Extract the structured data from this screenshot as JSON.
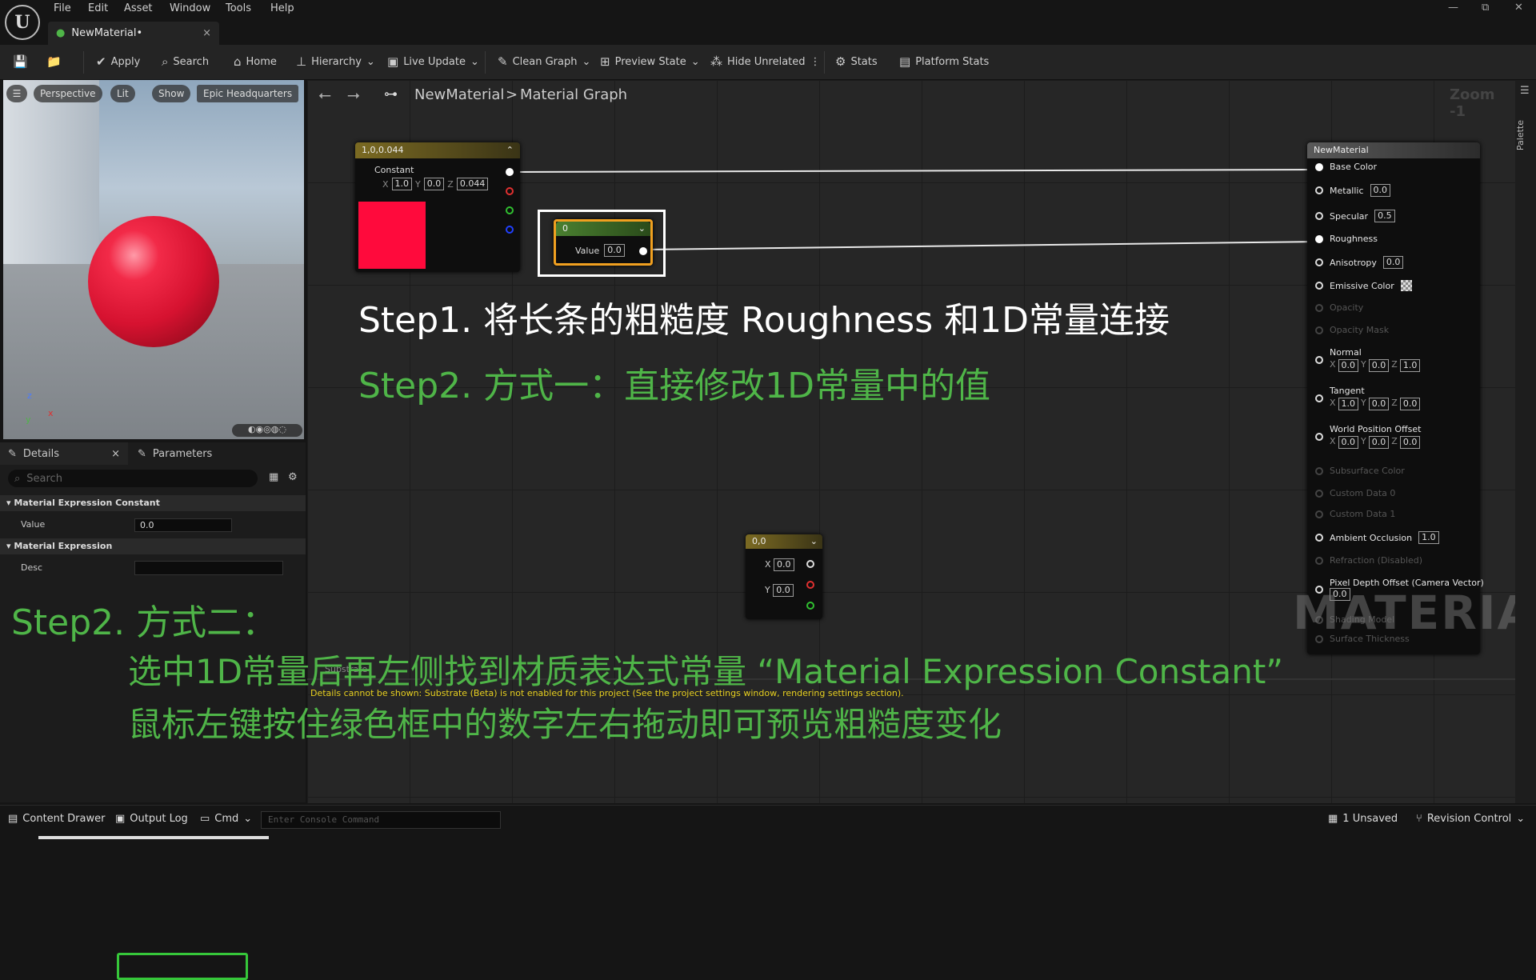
{
  "menu": [
    "File",
    "Edit",
    "Asset",
    "Window",
    "Tools",
    "Help"
  ],
  "tab": {
    "title": "NewMaterial•",
    "close": "×"
  },
  "window_controls": {
    "minimize": "—",
    "restore": "⧉",
    "close": "✕"
  },
  "toolbar": {
    "apply": "Apply",
    "search": "Search",
    "home": "Home",
    "hierarchy": "Hierarchy",
    "live_update": "Live Update",
    "clean_graph": "Clean Graph",
    "preview_state": "Preview State",
    "hide_unrelated": "Hide Unrelated",
    "stats": "Stats",
    "platform_stats": "Platform Stats"
  },
  "viewport": {
    "perspective": "Perspective",
    "lit": "Lit",
    "show": "Show",
    "level": "Epic Headquarters"
  },
  "details": {
    "tab_details": "Details",
    "tab_parameters": "Parameters",
    "search_placeholder": "Search",
    "section1": "Material Expression Constant",
    "value_label": "Value",
    "value": "0.0",
    "section2": "Material Expression",
    "desc_label": "Desc",
    "desc_value": ""
  },
  "graph": {
    "breadcrumb_root": "NewMaterial",
    "breadcrumb_sep": ">",
    "breadcrumb_leaf": "Material Graph",
    "zoom": "Zoom -1",
    "palette": "Palette",
    "watermark": "MATERIAL",
    "warning": "Details cannot be shown: Substrate (Beta) is not enabled for this project (See the project settings window, rendering settings section).",
    "substrate_label": "Substrate"
  },
  "node_color": {
    "title": "1,0,0.044",
    "sub": "Constant",
    "x": "1.0",
    "y": "0.0",
    "z": "0.044",
    "swatch": "#ff0a3c"
  },
  "node_scalar": {
    "title": "0",
    "value_label": "Value",
    "value": "0.0"
  },
  "node_vec2": {
    "title": "0,0",
    "x": "0.0",
    "y": "0.0"
  },
  "node_material": {
    "title": "NewMaterial",
    "pins": {
      "base_color": "Base Color",
      "metallic": "Metallic",
      "metallic_v": "0.0",
      "specular": "Specular",
      "specular_v": "0.5",
      "roughness": "Roughness",
      "anisotropy": "Anisotropy",
      "anisotropy_v": "0.0",
      "emissive": "Emissive Color",
      "opacity": "Opacity",
      "opacity_mask": "Opacity Mask",
      "normal": "Normal",
      "normal_x": "0.0",
      "normal_y": "0.0",
      "normal_z": "1.0",
      "tangent": "Tangent",
      "tangent_x": "1.0",
      "tangent_y": "0.0",
      "tangent_z": "0.0",
      "wpo": "World Position Offset",
      "wpo_x": "0.0",
      "wpo_y": "0.0",
      "wpo_z": "0.0",
      "subsurface": "Subsurface Color",
      "custom0": "Custom Data 0",
      "custom1": "Custom Data 1",
      "ao": "Ambient Occlusion",
      "ao_v": "1.0",
      "refraction": "Refraction (Disabled)",
      "pdo": "Pixel Depth Offset (Camera Vector)",
      "pdo_v": "0.0",
      "shading": "Shading Model",
      "surface": "Surface Thickness"
    }
  },
  "annotations": {
    "step1": "Step1. 将长条的粗糙度 Roughness 和1D常量连接",
    "step2a": "Step2. 方式一：直接修改1D常量中的值",
    "step2b_title": "Step2. 方式二：",
    "step2b_line1": "选中1D常量后再左侧找到材质表达式常量 “Material Expression Constant”",
    "step2b_line2": "鼠标左键按住绿色框中的数字左右拖动即可预览粗糙度变化",
    "white": "#ffffff",
    "green": "#4fb548"
  },
  "statusbar": {
    "content_drawer": "Content Drawer",
    "output_log": "Output Log",
    "cmd": "Cmd",
    "console_placeholder": "Enter Console Command",
    "unsaved": "1 Unsaved",
    "revision": "Revision Control"
  },
  "axes": {
    "z": "z",
    "x": "x",
    "y": "y"
  }
}
